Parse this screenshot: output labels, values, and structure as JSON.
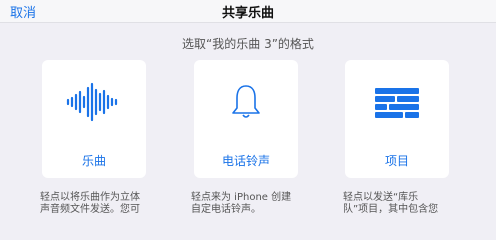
{
  "navbar": {
    "cancel_label": "取消",
    "title": "共享乐曲"
  },
  "subtitle": "选取“我的乐曲 3”的格式",
  "options": [
    {
      "label": "乐曲",
      "icon": "waveform-icon",
      "description_line1": "轻点以将乐曲作为立体",
      "description_line2": "声音频文件发送。您可"
    },
    {
      "label": "电话铃声",
      "icon": "bell-icon",
      "description_line1": "轻点来为 iPhone 创建",
      "description_line2": "自定电话铃声。"
    },
    {
      "label": "项目",
      "icon": "project-icon",
      "description_line1": "轻点以发送“库乐",
      "description_line2": "队”项目，其中包含您"
    }
  ],
  "colors": {
    "accent": "#1a73e8",
    "background": "#f0eff5",
    "card": "#ffffff"
  }
}
